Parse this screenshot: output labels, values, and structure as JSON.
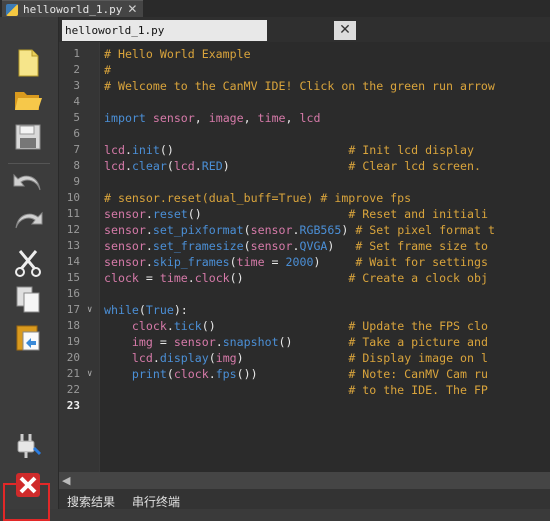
{
  "top_tab": {
    "label": "helloworld_1.py",
    "close": "✕"
  },
  "editor_tab": {
    "label": "helloworld_1.py",
    "close": "✕"
  },
  "code_lines": [
    {
      "n": "1",
      "t": "# Hello World Example"
    },
    {
      "n": "2",
      "t": "#"
    },
    {
      "n": "3",
      "t": "# Welcome to the CanMV IDE! Click on the green run arrow"
    },
    {
      "n": "4",
      "t": ""
    },
    {
      "n": "5",
      "t": "import sensor, image, time, lcd"
    },
    {
      "n": "6",
      "t": ""
    },
    {
      "n": "7",
      "t": "lcd.init()                         # Init lcd display"
    },
    {
      "n": "8",
      "t": "lcd.clear(lcd.RED)                 # Clear lcd screen."
    },
    {
      "n": "9",
      "t": ""
    },
    {
      "n": "10",
      "t": "# sensor.reset(dual_buff=True) # improve fps"
    },
    {
      "n": "11",
      "t": "sensor.reset()                     # Reset and initiali"
    },
    {
      "n": "12",
      "t": "sensor.set_pixformat(sensor.RGB565) # Set pixel format t"
    },
    {
      "n": "13",
      "t": "sensor.set_framesize(sensor.QVGA)   # Set frame size to"
    },
    {
      "n": "14",
      "t": "sensor.skip_frames(time = 2000)     # Wait for settings"
    },
    {
      "n": "15",
      "t": "clock = time.clock()               # Create a clock obj"
    },
    {
      "n": "16",
      "t": ""
    },
    {
      "n": "17",
      "t": "while(True):"
    },
    {
      "n": "18",
      "t": "    clock.tick()                   # Update the FPS clo"
    },
    {
      "n": "19",
      "t": "    img = sensor.snapshot()        # Take a picture and"
    },
    {
      "n": "20",
      "t": "    lcd.display(img)               # Display image on l"
    },
    {
      "n": "21",
      "t": "    print(clock.fps())             # Note: CanMV Cam ru"
    },
    {
      "n": "22",
      "t": "                                   # to the IDE. The FP"
    },
    {
      "n": "23",
      "t": ""
    }
  ],
  "current_line": "23",
  "status_tabs": [
    "搜索结果",
    "串行终端"
  ],
  "sidebar_icons": [
    "new-file-icon",
    "open-folder-icon",
    "save-icon",
    "undo-icon",
    "redo-icon",
    "cut-icon",
    "copy-icon",
    "paste-icon",
    "connect-icon",
    "stop-icon"
  ],
  "colors": {
    "comment": "#d9a43c",
    "keyword": "#4b8fd6",
    "identifier": "#d67aa9",
    "highlight": "#e22828"
  }
}
